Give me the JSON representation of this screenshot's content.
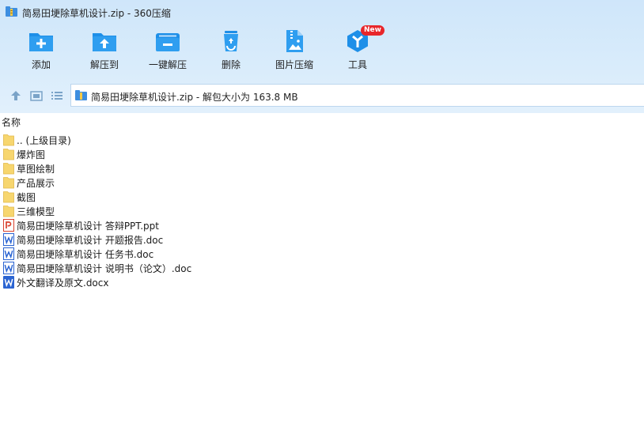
{
  "window": {
    "title": "简易田埂除草机设计.zip - 360压缩"
  },
  "toolbar": {
    "items": [
      {
        "label": "添加",
        "icon": "add-folder-icon"
      },
      {
        "label": "解压到",
        "icon": "extract-to-icon"
      },
      {
        "label": "一键解压",
        "icon": "one-click-extract-icon"
      },
      {
        "label": "删除",
        "icon": "recycle-bin-icon"
      },
      {
        "label": "图片压缩",
        "icon": "image-compress-icon"
      },
      {
        "label": "工具",
        "icon": "tools-icon",
        "badge": "New"
      }
    ]
  },
  "nav": {
    "path": "简易田埂除草机设计.zip - 解包大小为 163.8 MB"
  },
  "list": {
    "header_name": "名称",
    "items": [
      {
        "name": ".. (上级目录)",
        "type": "folder"
      },
      {
        "name": "爆炸图",
        "type": "folder"
      },
      {
        "name": "草图绘制",
        "type": "folder"
      },
      {
        "name": "产品展示",
        "type": "folder"
      },
      {
        "name": "截图",
        "type": "folder"
      },
      {
        "name": "三维模型",
        "type": "folder"
      },
      {
        "name": "简易田埂除草机设计 答辩PPT.ppt",
        "type": "ppt"
      },
      {
        "name": "简易田埂除草机设计 开题报告.doc",
        "type": "doc"
      },
      {
        "name": "简易田埂除草机设计 任务书.doc",
        "type": "doc"
      },
      {
        "name": "简易田埂除草机设计 说明书（论文）.doc",
        "type": "doc"
      },
      {
        "name": "外文翻译及原文.docx",
        "type": "docx"
      }
    ]
  },
  "colors": {
    "accent": "#1e8fe8",
    "folder": "#f7d66f",
    "ppt": "#d9432f",
    "word": "#2b64d2",
    "badge": "#e8262a"
  }
}
